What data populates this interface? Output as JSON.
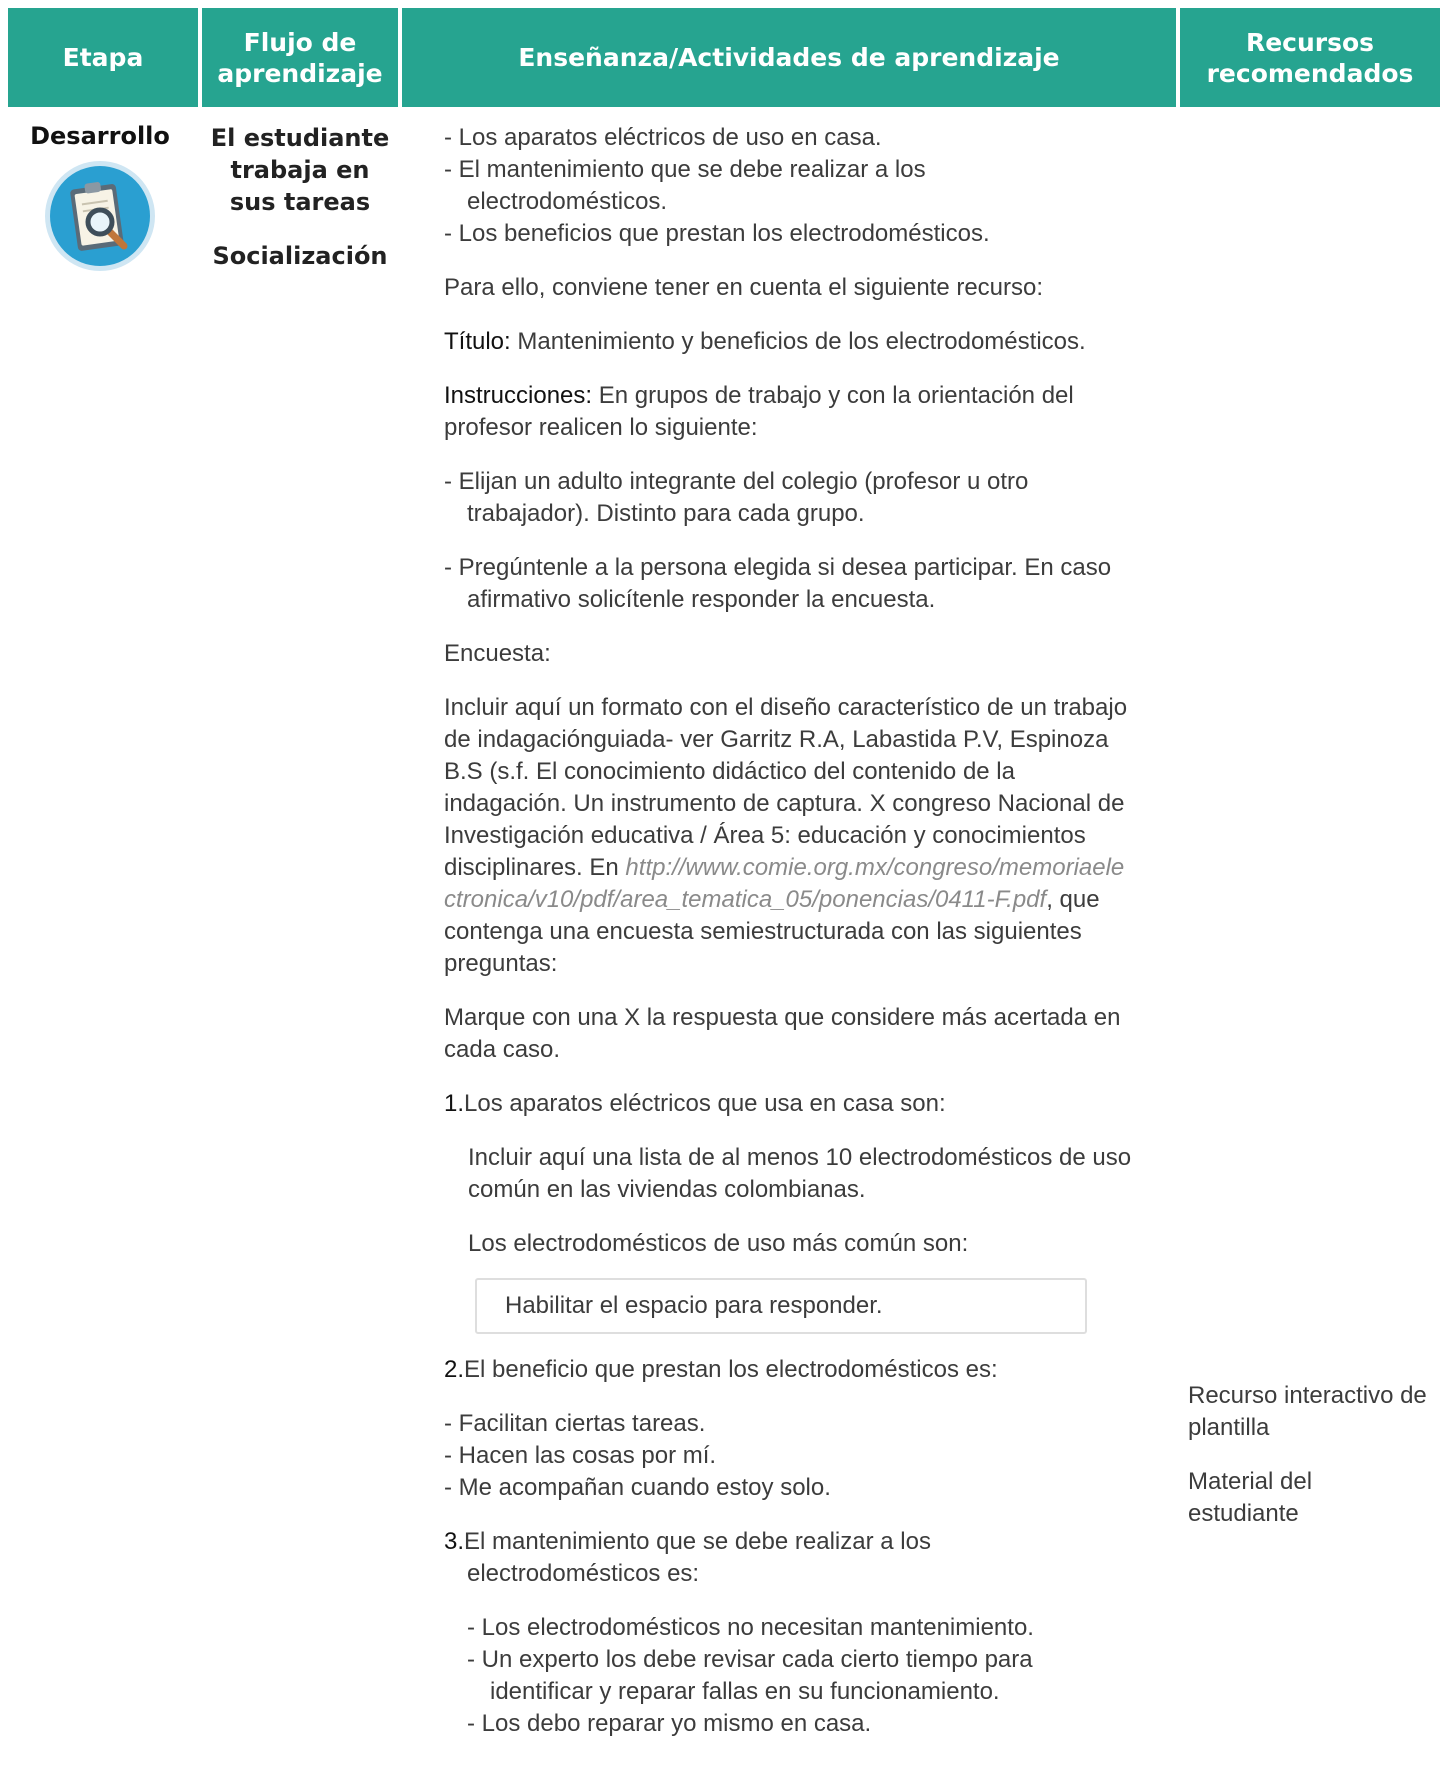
{
  "header": {
    "etapa": "Etapa",
    "flujo_line1": "Flujo de",
    "flujo_line2": "aprendizaje",
    "ensenanza": "Enseñanza/Actividades de aprendizaje",
    "recursos_line1": "Recursos",
    "recursos_line2": "recomendados",
    "color": "#26a490"
  },
  "etapa": {
    "label": "Desarrollo",
    "icon": "clipboard-magnifier-icon"
  },
  "flujo": {
    "line1": "El estudiante",
    "line2": "trabaja en",
    "line3": "sus tareas",
    "social": "Socialización"
  },
  "main": {
    "intro_items": [
      "- Los aparatos eléctricos de uso en casa.",
      "- El mantenimiento que se debe realizar a los electrodomésticos.",
      "- Los beneficios que prestan los electrodomésticos."
    ],
    "para_ello": "Para ello, conviene tener en cuenta el siguiente recurso:",
    "titulo_label": "Título:",
    "titulo_text": " Mantenimiento y beneficios de los electrodomésticos.",
    "instr_label": "Instrucciones:",
    "instr_text": " En grupos de trabajo y con la orientación del profesor realicen lo siguiente:",
    "steps": [
      "- Elijan un adulto integrante del colegio (profesor u otro trabajador). Distinto para cada grupo.",
      "- Pregúntenle a la persona elegida si desea participar. En caso afirmativo solicítenle responder la encuesta."
    ],
    "encuesta": "Encuesta:",
    "incluir_a": "Incluir aquí un formato con el diseño característico de un trabajo de indagaciónguiada- ver Garritz R.A, Labastida P.V, Espinoza B.S (s.f. El conocimiento didáctico del contenido de la indagación. Un instrumento de captura. X congreso Nacional de Investigación educativa / Área 5: educación y conocimientos disciplinares. En ",
    "incluir_link": "http://www.comie.org.mx/congreso/memoriaelectronica/v10/pdf/area_tematica_05/ponencias/0411-F.pdf",
    "incluir_b": ", que contenga una encuesta semiestructurada con las siguientes preguntas:",
    "marque": "Marque con una X la respuesta que considere más acertada en cada caso.",
    "q1_num": "1.",
    "q1_text": "Los aparatos eléctricos que usa en casa son:",
    "q1_incluir": "Incluir aquí una lista de al menos 10 electrodomésticos de uso común en las viviendas colombianas.",
    "q1_comun": "Los electrodomésticos de uso más común son:",
    "answer_placeholder": "Habilitar el espacio para responder.",
    "q2_num": "2.",
    "q2_text": "El beneficio que prestan los electrodomésticos es:",
    "q2_options": [
      "- Facilitan ciertas tareas.",
      "- Hacen las cosas por mí.",
      "- Me acompañan cuando estoy solo."
    ],
    "q3_num": "3.",
    "q3_text": "El mantenimiento que se debe realizar a los electrodomésticos es:",
    "q3_options": [
      "- Los electrodomésticos no necesitan mantenimiento.",
      "- Un experto los debe revisar cada cierto tiempo para identificar y reparar fallas en su funcionamiento.",
      "- Los debo reparar yo mismo en casa."
    ]
  },
  "recursos": {
    "item1": "Recurso interactivo de plantilla",
    "item2": "Material del estudiante"
  }
}
